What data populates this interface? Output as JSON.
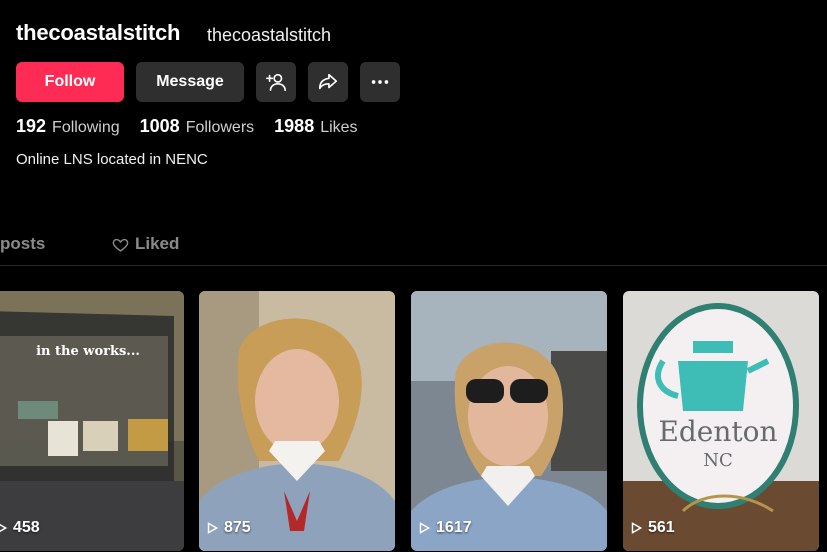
{
  "profile": {
    "username": "thecoastalstitch",
    "nickname": "thecoastalstitch",
    "bio": "Online LNS located in NENC"
  },
  "actions": {
    "follow_label": "Follow",
    "message_label": "Message",
    "add_friend_icon": "add-user-icon",
    "share_icon": "share-icon",
    "more_icon": "more-icon"
  },
  "stats": {
    "following": {
      "value": "192",
      "label": "Following"
    },
    "followers": {
      "value": "1008",
      "label": "Followers"
    },
    "likes": {
      "value": "1988",
      "label": "Likes"
    }
  },
  "tabs": {
    "posts": "posts",
    "liked": "Liked"
  },
  "videos": [
    {
      "views": "458",
      "overlay_text": "in the works..."
    },
    {
      "views": "875"
    },
    {
      "views": "1617"
    },
    {
      "views": "561",
      "overlay_text_1": "Edenton",
      "overlay_text_2": "NC"
    }
  ],
  "colors": {
    "accent": "#fe2c55",
    "secondary_button": "#2f2f2f",
    "background": "#000000"
  }
}
